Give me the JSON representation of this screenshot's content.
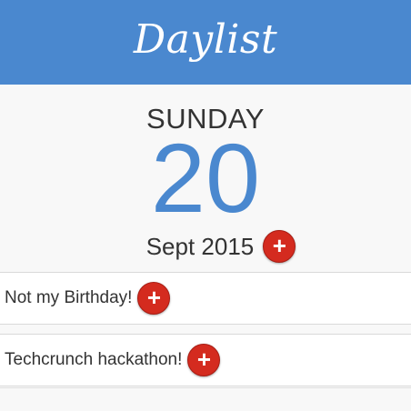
{
  "app": {
    "title": "Daylist",
    "accent_color": "#4a88cf",
    "add_button_color": "#d42b1f"
  },
  "date": {
    "weekday": "SUNDAY",
    "day": "20",
    "month_year": "Sept 2015",
    "add_icon": "plus-icon"
  },
  "events": [
    {
      "label": "Not my Birthday!",
      "add_icon": "plus-icon"
    },
    {
      "label": "Techcrunch hackathon!",
      "add_icon": "plus-icon"
    }
  ],
  "icons": {
    "plus": "+"
  }
}
